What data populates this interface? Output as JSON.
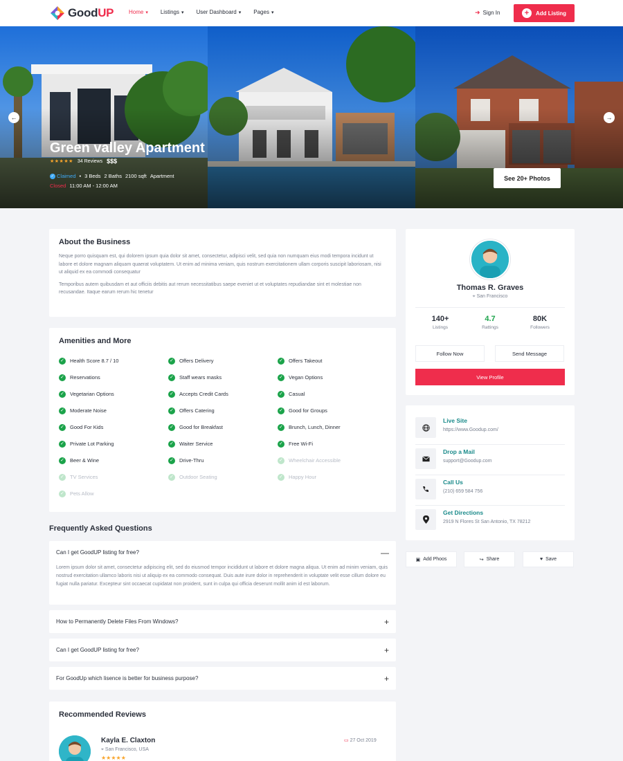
{
  "header": {
    "logo_text_a": "Good",
    "logo_text_b": "UP",
    "nav": [
      {
        "label": "Home"
      },
      {
        "label": "Listings"
      },
      {
        "label": "User Dashboard"
      },
      {
        "label": "Pages"
      }
    ],
    "signin": "Sign In",
    "add_listing": "Add Listing"
  },
  "hero": {
    "title": "Green valley Apartment",
    "stars": "★★★★★",
    "reviews": "34 Reviews",
    "price": "$$$",
    "claimed": "Claimed",
    "beds": "3 Beds",
    "baths": "2 Baths",
    "area": "2100 sqft",
    "type": "Apartment",
    "status": "Closed",
    "hours": "11:00 AM - 12:00 AM",
    "photos_button": "See 20+ Photos"
  },
  "about": {
    "title": "About the Business",
    "p1": "Neque porro quisquam est, qui dolorem ipsum quia dolor sit amet, consectetur, adipisci velit, sed quia non numquam eius modi tempora incidunt ut labore et dolore magnam aliquam quaerat voluptatem. Ut enim ad minima veniam, quis nostrum exercitationem ullam corporis suscipit laboriosam, nisi ut aliquid ex ea commodi consequatur",
    "p2": "Temporibus autem quibusdam et aut officiis debitis aut rerum necessitatibus saepe eveniet ut et voluptates repudiandae sint et molestiae non recusandae. Itaque earum rerum hic tenetur"
  },
  "amenities": {
    "title": "Amenities and More",
    "items": [
      {
        "label": "Health Score 8.7 / 10",
        "available": true
      },
      {
        "label": "Offers Delivery",
        "available": true
      },
      {
        "label": "Offers Takeout",
        "available": true
      },
      {
        "label": "Reservations",
        "available": true
      },
      {
        "label": "Staff wears masks",
        "available": true
      },
      {
        "label": "Vegan Options",
        "available": true
      },
      {
        "label": "Vegetarian Options",
        "available": true
      },
      {
        "label": "Accepts Credit Cards",
        "available": true
      },
      {
        "label": "Casual",
        "available": true
      },
      {
        "label": "Moderate Noise",
        "available": true
      },
      {
        "label": "Offers Catering",
        "available": true
      },
      {
        "label": "Good for Groups",
        "available": true
      },
      {
        "label": "Good For Kids",
        "available": true
      },
      {
        "label": "Good for Breakfast",
        "available": true
      },
      {
        "label": "Brunch, Lunch, Dinner",
        "available": true
      },
      {
        "label": "Private Lot Parking",
        "available": true
      },
      {
        "label": "Waiter Service",
        "available": true
      },
      {
        "label": "Free Wi-Fi",
        "available": true
      },
      {
        "label": "Beer & Wine",
        "available": true
      },
      {
        "label": "Drive-Thru",
        "available": true
      },
      {
        "label": "Wheelchair Accessible",
        "available": false
      },
      {
        "label": "TV Services",
        "available": false
      },
      {
        "label": "Outdoor Seating",
        "available": false
      },
      {
        "label": "Happy Hour",
        "available": false
      },
      {
        "label": "Pets Allow",
        "available": false
      }
    ]
  },
  "faq": {
    "title": "Frequently Asked Questions",
    "items": [
      {
        "q": "Can I get GoodUP listing for free?",
        "open": true,
        "toggle": "—",
        "a": "Lorem ipsum dolor sit amet, consectetur adipiscing elit, sed do eiusmod tempor incididunt ut labore et dolore magna aliqua. Ut enim ad minim veniam, quis nostrud exercitation ullamco laboris nisi ut aliquip ex ea commodo consequat. Duis aute irure dolor in reprehenderit in voluptate velit esse cillum dolore eu fugiat nulla pariatur. Excepteur sint occaecat cupidatat non proident, sunt in culpa qui officia deserunt mollit anim id est laborum."
      },
      {
        "q": "How to Permanently Delete Files From Windows?",
        "open": false,
        "toggle": "+"
      },
      {
        "q": "Can I get GoodUP listing for free?",
        "open": false,
        "toggle": "+"
      },
      {
        "q": "For GoodUp which lisence is better for business purpose?",
        "open": false,
        "toggle": "+"
      }
    ]
  },
  "reviews": {
    "title": "Recommended Reviews",
    "first": {
      "name": "Kayla E. Claxton",
      "location": "San Francisco, USA",
      "date": "27 Oct 2019",
      "stars": "★★★★★"
    }
  },
  "profile": {
    "name": "Thomas R. Graves",
    "location": "San Francisco",
    "stats": [
      {
        "value": "140+",
        "label": "Listings"
      },
      {
        "value": "4.7",
        "label": "Rattings"
      },
      {
        "value": "80K",
        "label": "Followers"
      }
    ],
    "follow": "Follow Now",
    "message": "Send Message",
    "view": "View Profile"
  },
  "contact": [
    {
      "title": "Live Site",
      "value": "https://www.Goodup.com/",
      "icon": "globe-icon"
    },
    {
      "title": "Drop a Mail",
      "value": "support@Goodup.com",
      "icon": "mail-icon"
    },
    {
      "title": "Call Us",
      "value": "(210) 659 584 756",
      "icon": "phone-icon"
    },
    {
      "title": "Get Directions",
      "value": "2919 N Flores St San Antonio, TX 78212",
      "icon": "map-pin-icon"
    }
  ],
  "actions": {
    "photos": "Add Phoos",
    "share": "Share",
    "save": "Save"
  },
  "colors": {
    "accent": "#ef2d4c",
    "green": "#1ba34a",
    "teal": "#1a8a8a"
  }
}
